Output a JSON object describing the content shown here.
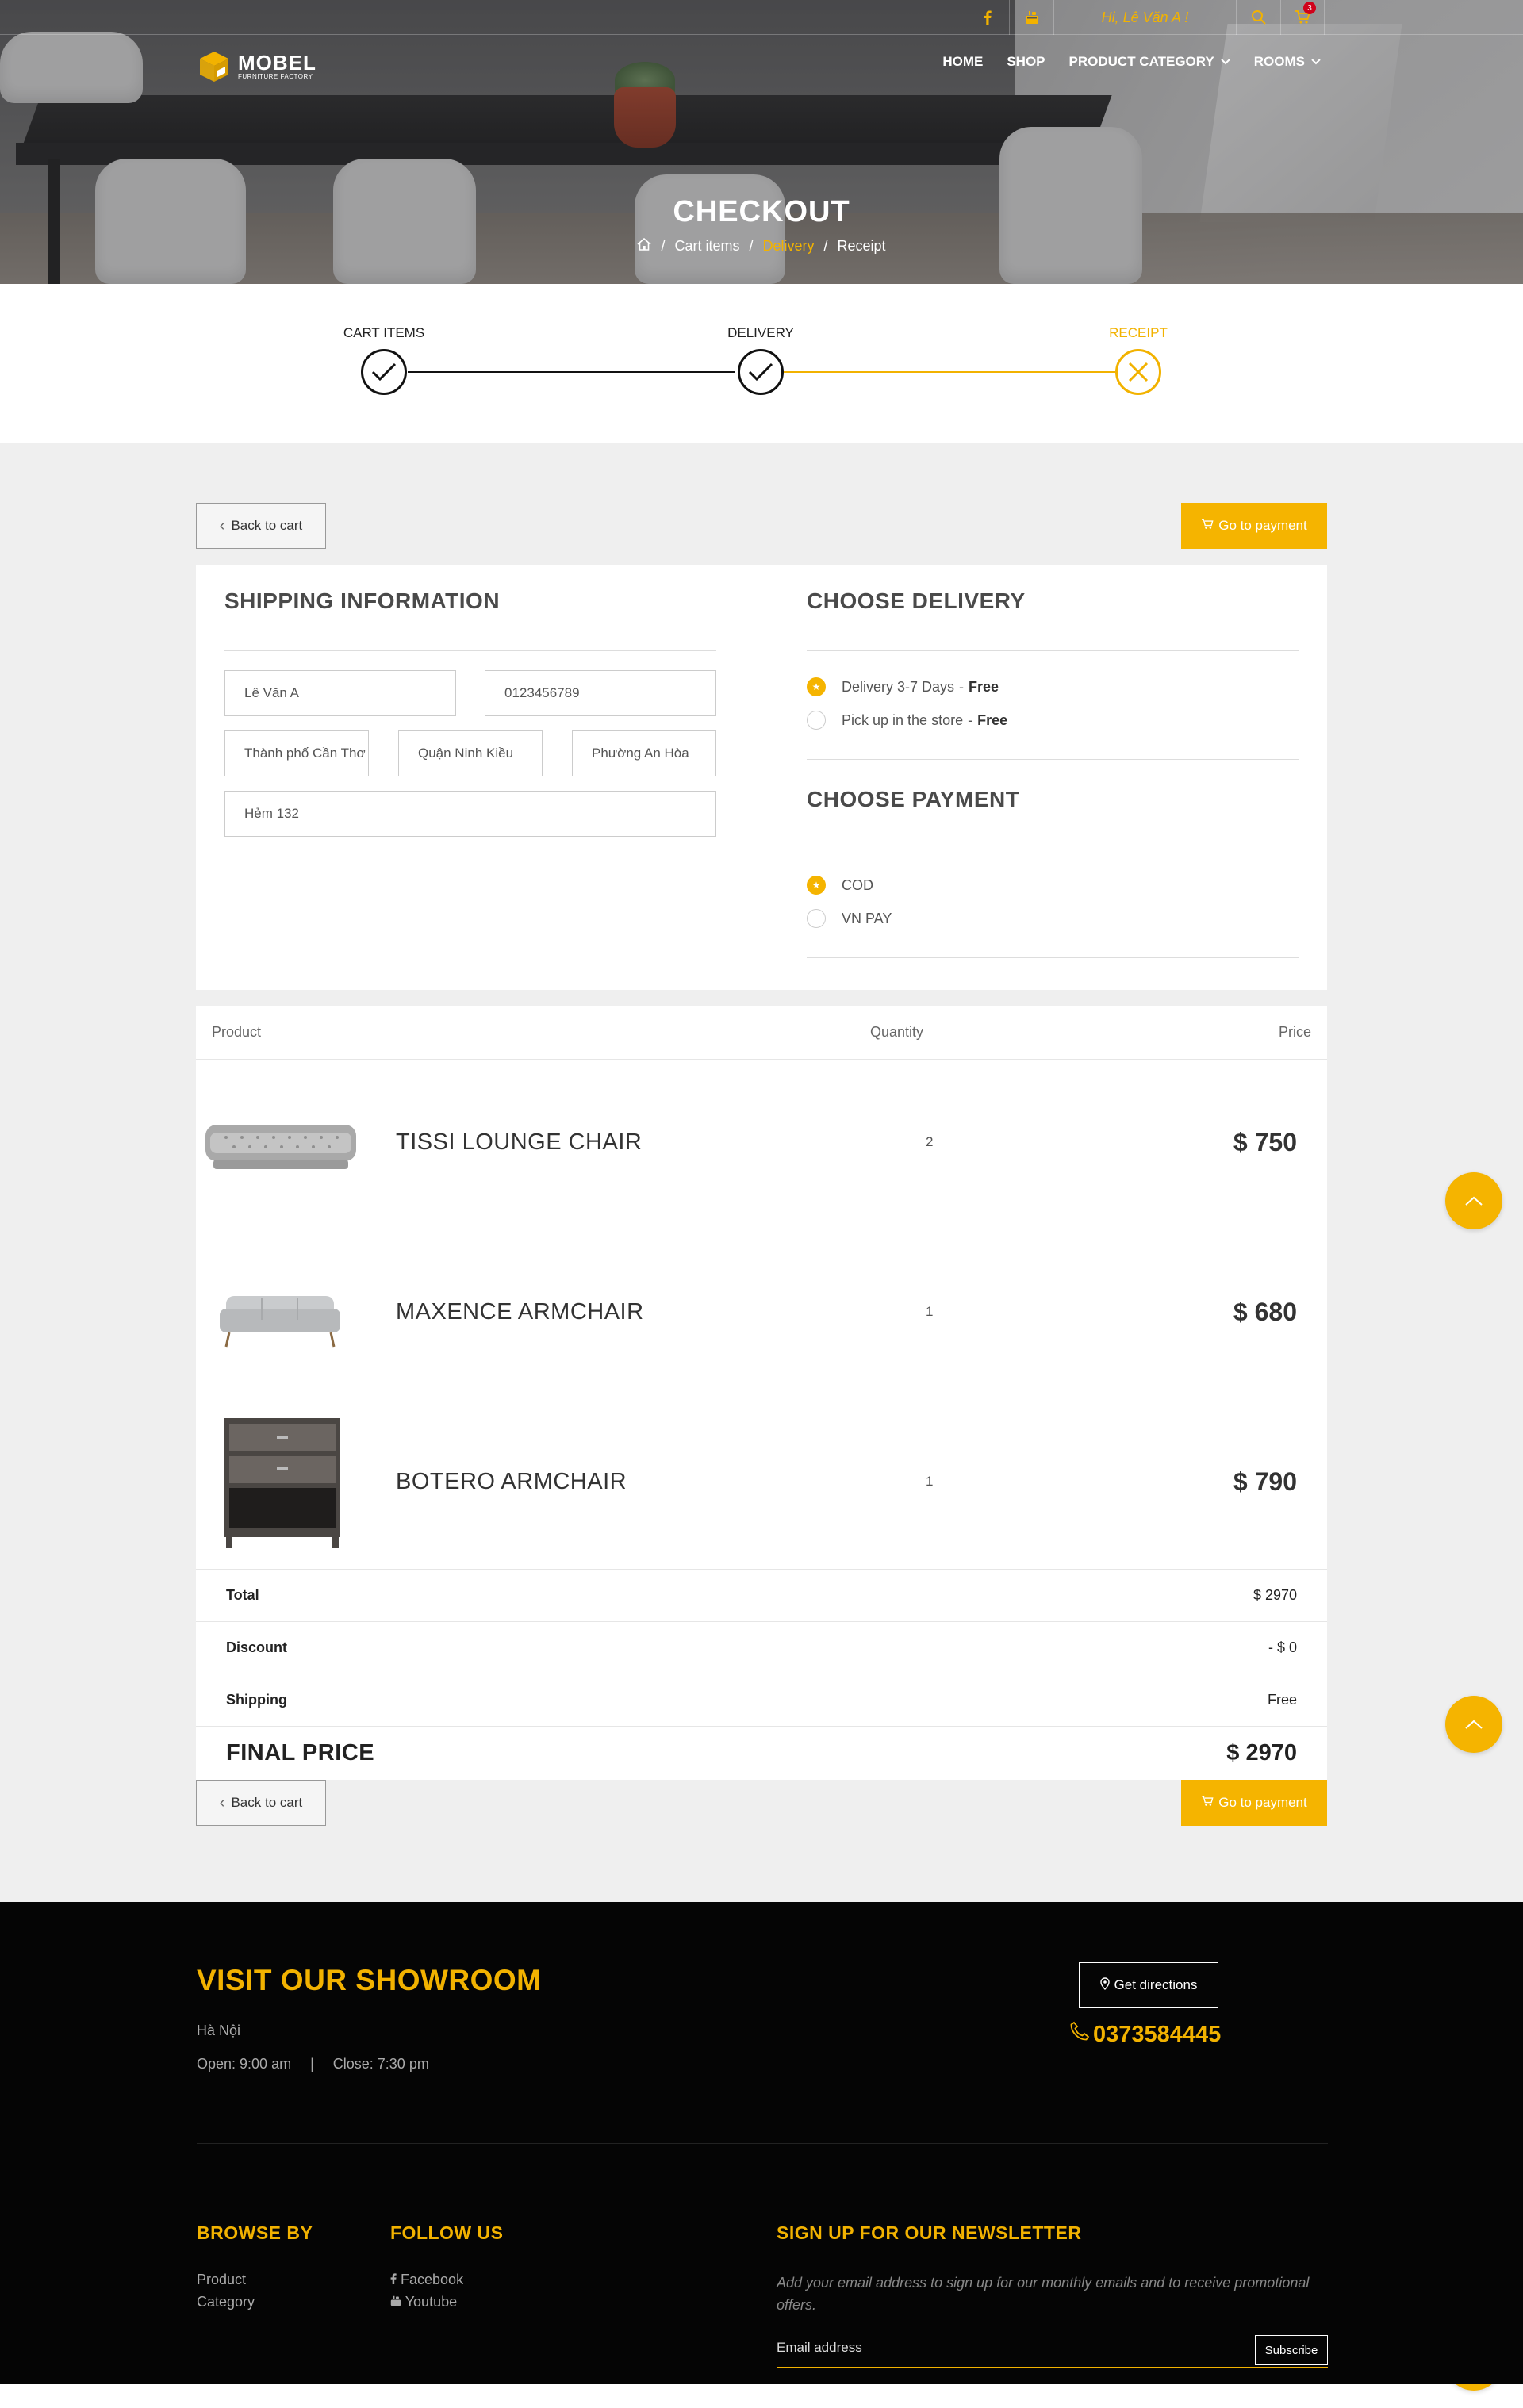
{
  "topbar": {
    "greeting": "Hi, Lê Văn A !",
    "cart_count": "3",
    "icons": [
      "facebook-icon",
      "youtube-icon",
      "search-icon",
      "cart-icon"
    ]
  },
  "brand": {
    "name": "MOBEL",
    "tagline": "FURNITURE FACTORY",
    "accent_color": "#f2b200"
  },
  "menu": {
    "home": "HOME",
    "shop": "SHOP",
    "product_category": "PRODUCT CATEGORY",
    "rooms": "ROOMS"
  },
  "hero": {
    "title": "CHECKOUT",
    "breadcrumb": [
      "Cart items",
      "Delivery",
      "Receipt"
    ],
    "breadcrumb_sep": "/"
  },
  "steps": [
    {
      "label": "CART ITEMS",
      "state": "done"
    },
    {
      "label": "DELIVERY",
      "state": "done"
    },
    {
      "label": "RECEIPT",
      "state": "active"
    }
  ],
  "actions": {
    "back_to_cart": "Back to cart",
    "go_to_payment": "Go to payment"
  },
  "shipping": {
    "title": "SHIPPING INFORMATION",
    "name": "Lê Văn A",
    "phone": "0123456789",
    "city": "Thành phố Cần Thơ",
    "district": "Quận Ninh Kiều",
    "ward": "Phường An Hòa",
    "address": "Hẻm 132"
  },
  "delivery": {
    "title": "CHOOSE DELIVERY",
    "options": [
      {
        "label": "Delivery 3-7 Days",
        "sep": "-",
        "price": "Free",
        "selected": true
      },
      {
        "label": "Pick up in the store",
        "sep": "-",
        "price": "Free",
        "selected": false
      }
    ]
  },
  "payment": {
    "title": "CHOOSE PAYMENT",
    "options": [
      {
        "label": "COD",
        "selected": true
      },
      {
        "label": "VN PAY",
        "selected": false
      }
    ]
  },
  "table": {
    "headers": {
      "product": "Product",
      "quantity": "Quantity",
      "price": "Price"
    },
    "rows": [
      {
        "name": "TISSI LOUNGE CHAIR",
        "quantity": "2",
        "price": "$ 750",
        "image": "tufted-sofa"
      },
      {
        "name": "MAXENCE ARMCHAIR",
        "quantity": "1",
        "price": "$ 680",
        "image": "grey-sofa"
      },
      {
        "name": "BOTERO ARMCHAIR",
        "quantity": "1",
        "price": "$ 790",
        "image": "nightstand"
      }
    ]
  },
  "summary": {
    "total_label": "Total",
    "total": "$ 2970",
    "discount_label": "Discount",
    "discount": "- $ 0",
    "shipping_label": "Shipping",
    "shipping": "Free",
    "final_label": "FINAL PRICE",
    "final": "$ 2970"
  },
  "footer": {
    "showroom_title": "VISIT OUR SHOWROOM",
    "city": "Hà Nội",
    "open": "Open: 9:00 am",
    "hours_sep": "|",
    "close": "Close: 7:30 pm",
    "directions": "Get directions",
    "phone": "0373584445",
    "browse_title": "BROWSE BY",
    "browse_links": [
      "Product",
      "Category"
    ],
    "follow_title": "FOLLOW US",
    "follow_links": [
      "Facebook",
      "Youtube"
    ],
    "newsletter_title": "SIGN UP FOR OUR NEWSLETTER",
    "newsletter_text": "Add your email address to sign up for our monthly emails and to receive promotional offers.",
    "email_placeholder": "Email address",
    "subscribe": "Subscribe"
  }
}
